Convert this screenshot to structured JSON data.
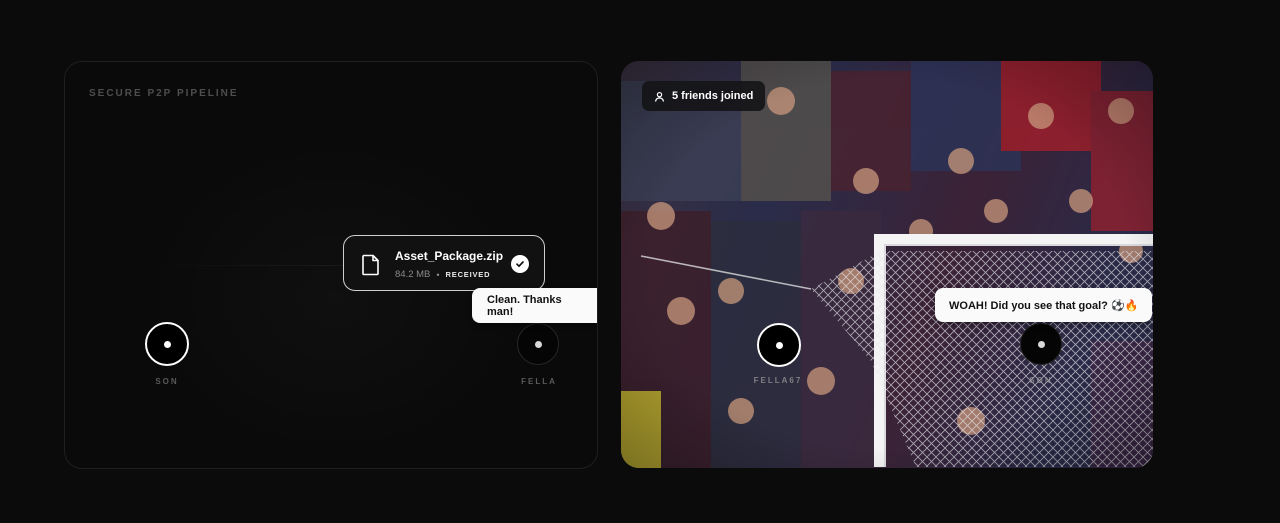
{
  "pipeline": {
    "section_label": "SECURE P2P PIPELINE",
    "sender": {
      "label": "SON",
      "icon": "node-dot-icon"
    },
    "receiver": {
      "label": "FELLA",
      "icon": "node-dot-icon"
    },
    "file": {
      "name": "Asset_Package.zip",
      "size": "84.2 MB",
      "separator": "•",
      "status": "RECEIVED",
      "icon": "file-icon",
      "status_icon": "check-circle-icon"
    },
    "message": "Clean. Thanks man!"
  },
  "watch_party": {
    "friends_label": "5 friends joined",
    "friends_icon": "user-icon",
    "participant_left": {
      "label": "FELLA67"
    },
    "participant_right": {
      "label": "SON"
    },
    "message": "WOAH! Did you see that goal? ⚽🔥",
    "background": "stadium-crowd-goal-net-image"
  },
  "colors": {
    "page_bg": "#0b0b0b",
    "card_bg": "#0a0a0a",
    "bubble_bg": "#fafafa",
    "accent": "#ffffff",
    "muted_text": "#5a5a5a"
  }
}
